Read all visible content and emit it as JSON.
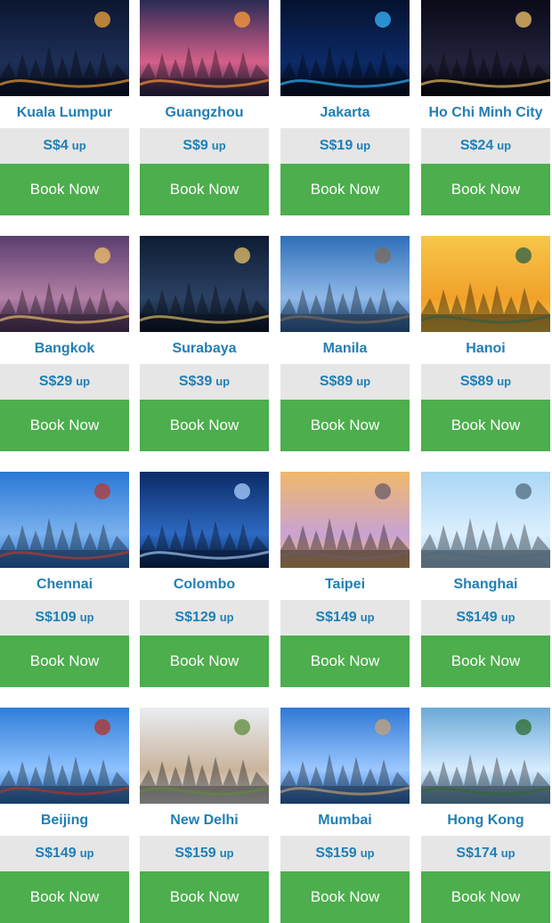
{
  "cards": [
    {
      "city": "Kuala Lumpur",
      "price": "S$4",
      "suffix": "up",
      "button": "Book Now",
      "palette": [
        "#0b1630",
        "#1e2f57",
        "#f0a43a"
      ]
    },
    {
      "city": "Guangzhou",
      "price": "S$9",
      "suffix": "up",
      "button": "Book Now",
      "palette": [
        "#2a2b55",
        "#d5608a",
        "#ff9d3a"
      ]
    },
    {
      "city": "Jakarta",
      "price": "S$19",
      "suffix": "up",
      "button": "Book Now",
      "palette": [
        "#05122f",
        "#0c2a66",
        "#35b8ff"
      ]
    },
    {
      "city": "Ho Chi Minh City",
      "price": "S$24",
      "suffix": "up",
      "button": "Book Now",
      "palette": [
        "#0a0a18",
        "#22223c",
        "#f4c56a"
      ]
    },
    {
      "city": "Bangkok",
      "price": "S$29",
      "suffix": "up",
      "button": "Book Now",
      "palette": [
        "#5b3d6f",
        "#b27fa5",
        "#f2c26b"
      ]
    },
    {
      "city": "Surabaya",
      "price": "S$39",
      "suffix": "up",
      "button": "Book Now",
      "palette": [
        "#0e1c33",
        "#2b4163",
        "#e7c16a"
      ]
    },
    {
      "city": "Manila",
      "price": "S$89",
      "suffix": "up",
      "button": "Book Now",
      "palette": [
        "#2f6fb9",
        "#8fb9e8",
        "#7d6a57"
      ]
    },
    {
      "city": "Hanoi",
      "price": "S$89",
      "suffix": "up",
      "button": "Book Now",
      "palette": [
        "#f7c74a",
        "#f1a12a",
        "#2b5d46"
      ]
    },
    {
      "city": "Chennai",
      "price": "S$109",
      "suffix": "up",
      "button": "Book Now",
      "palette": [
        "#2a78d6",
        "#7ab1ee",
        "#b63a32"
      ]
    },
    {
      "city": "Colombo",
      "price": "S$129",
      "suffix": "up",
      "button": "Book Now",
      "palette": [
        "#0b2b66",
        "#2d69c2",
        "#a9d0ff"
      ]
    },
    {
      "city": "Taipei",
      "price": "S$149",
      "suffix": "up",
      "button": "Book Now",
      "palette": [
        "#f0b86a",
        "#c9a3d2",
        "#6a5b67"
      ]
    },
    {
      "city": "Shanghai",
      "price": "S$149",
      "suffix": "up",
      "button": "Book Now",
      "palette": [
        "#a9d6f5",
        "#dbeffe",
        "#4f6a7f"
      ]
    },
    {
      "city": "Beijing",
      "price": "S$149",
      "suffix": "up",
      "button": "Book Now",
      "palette": [
        "#2f7dd8",
        "#8fc3ff",
        "#b73225"
      ]
    },
    {
      "city": "New Delhi",
      "price": "S$159",
      "suffix": "up",
      "button": "Book Now",
      "palette": [
        "#e9edf2",
        "#c9b49c",
        "#5e8b3b"
      ]
    },
    {
      "city": "Mumbai",
      "price": "S$159",
      "suffix": "up",
      "button": "Book Now",
      "palette": [
        "#2f78d5",
        "#9cc8ff",
        "#c6a175"
      ]
    },
    {
      "city": "Hong Kong",
      "price": "S$174",
      "suffix": "up",
      "button": "Book Now",
      "palette": [
        "#6ba9d6",
        "#d7ecff",
        "#2e6b2f"
      ]
    }
  ]
}
